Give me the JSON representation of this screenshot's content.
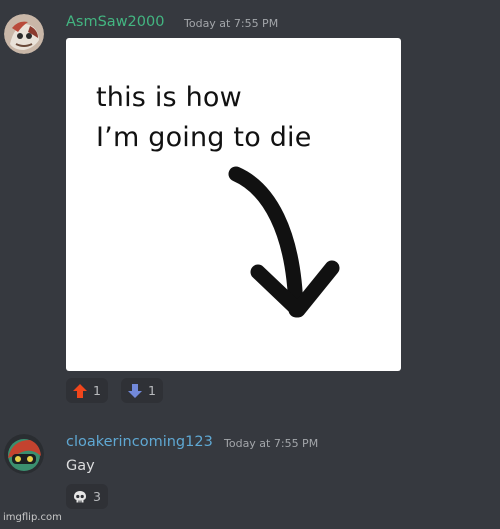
{
  "messages": [
    {
      "username": "AsmSaw2000",
      "username_color": "#43b581",
      "timestamp": "Today at 7:55 PM",
      "image_text": [
        "this is how",
        "I’m going to die"
      ],
      "reactions": [
        {
          "icon": "up-arrow-icon",
          "count": "1"
        },
        {
          "icon": "down-arrow-icon",
          "count": "1"
        }
      ]
    },
    {
      "username": "cloakerincoming123",
      "username_color": "#5fa8d3",
      "timestamp": "Today at 7:55 PM",
      "text": "Gay",
      "reactions": [
        {
          "icon": "skull-icon",
          "count": "3"
        }
      ]
    }
  ],
  "watermark": "imgflip.com"
}
